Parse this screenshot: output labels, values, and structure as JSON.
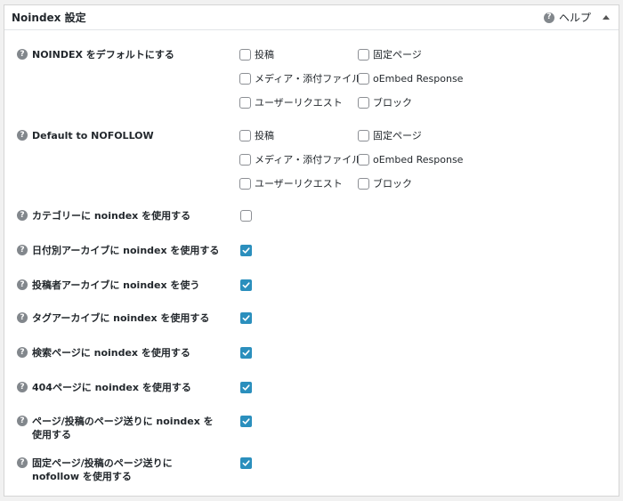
{
  "panel": {
    "title": "Noindex 設定",
    "help_label": "ヘルプ"
  },
  "noindex_default": {
    "label": "NOINDEX をデフォルトにする",
    "options": [
      "投稿",
      "固定ページ",
      "メディア・添付ファイル",
      "oEmbed Response",
      "ユーザーリクエスト",
      "ブロック"
    ]
  },
  "nofollow_default": {
    "label": "Default to NOFOLLOW",
    "options": [
      "投稿",
      "固定ページ",
      "メディア・添付ファイル",
      "oEmbed Response",
      "ユーザーリクエスト",
      "ブロック"
    ]
  },
  "settings": [
    {
      "label": "カテゴリーに noindex を使用する",
      "label2": "",
      "checked": false
    },
    {
      "label": "日付別アーカイブに noindex を使用する",
      "label2": "",
      "checked": true
    },
    {
      "label": "投稿者アーカイブに noindex を使う",
      "label2": "",
      "checked": true
    },
    {
      "label": "タグアーカイブに noindex を使用する",
      "label2": "",
      "checked": true
    },
    {
      "label": "検索ページに noindex を使用する",
      "label2": "",
      "checked": true
    },
    {
      "label": "404ページに noindex を使用する",
      "label2": "",
      "checked": true
    },
    {
      "label": "ページ/投稿のページ送りに noindex を",
      "label2": "使用する",
      "checked": true
    },
    {
      "label": "固定ページ/投稿のページ送りに",
      "label2": "nofollow を使用する",
      "checked": true
    }
  ],
  "colors": {
    "checked": "#2b8fbd",
    "help_icon": "#82878c"
  }
}
